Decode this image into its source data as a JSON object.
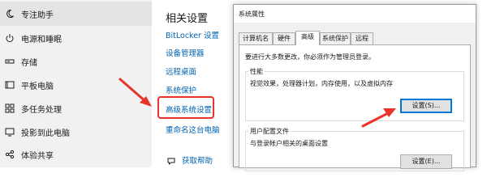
{
  "nav": {
    "items": [
      {
        "label": "专注助手",
        "icon": "moon-icon"
      },
      {
        "label": "电源和睡眠",
        "icon": "power-icon"
      },
      {
        "label": "存储",
        "icon": "storage-icon"
      },
      {
        "label": "平板电脑",
        "icon": "tablet-icon"
      },
      {
        "label": "多任务处理",
        "icon": "multitask-icon"
      },
      {
        "label": "投影到此电脑",
        "icon": "project-icon"
      },
      {
        "label": "体验共享",
        "icon": "share-icon"
      }
    ]
  },
  "related": {
    "title": "相关设置",
    "links": [
      "BitLocker 设置",
      "设备管理器",
      "远程桌面",
      "系统保护",
      "高级系统设置",
      "重命名这台电脑"
    ],
    "help": "获取帮助"
  },
  "dialog": {
    "title": "系统属性",
    "tabs": [
      "计算机名",
      "硬件",
      "高级",
      "系统保护",
      "远程"
    ],
    "active_tab": "高级",
    "admin_note": "要进行大多数更改，你必须作为管理员登录。",
    "performance": {
      "label": "性能",
      "desc": "视觉效果，处理器计划，内存使用，以及虚拟内存",
      "button": "设置(S)..."
    },
    "profiles": {
      "label": "用户配置文件",
      "desc": "与登录帐户相关的桌面设置",
      "button": "设置(E)..."
    }
  },
  "colors": {
    "link": "#0063b1",
    "annotation": "#e8342a",
    "focus": "#0078d7"
  }
}
